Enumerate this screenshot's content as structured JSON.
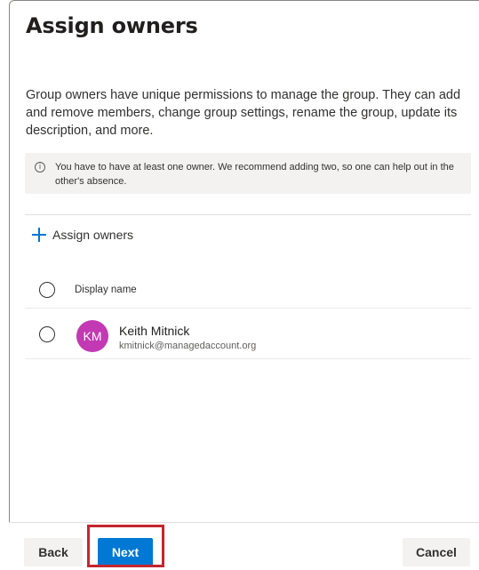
{
  "page": {
    "title": "Assign owners",
    "description": "Group owners have unique permissions to manage the group. They can add and remove members, change group settings, rename the group, update its description, and more."
  },
  "info": {
    "icon": "info-icon",
    "glyph": "i",
    "text": "You have to have at least one owner. We recommend adding two, so one can help out in the other's absence."
  },
  "command": {
    "icon": "plus-icon",
    "label": "Assign owners"
  },
  "table": {
    "column_header": "Display name",
    "rows": [
      {
        "initials": "KM",
        "name": "Keith Mitnick",
        "email": "kmitnick@managedaccount.org",
        "avatar_color": "#c239b3"
      }
    ]
  },
  "footer": {
    "back_label": "Back",
    "next_label": "Next",
    "cancel_label": "Cancel"
  },
  "colors": {
    "accent": "#0078d4",
    "highlight": "#c4262e"
  }
}
